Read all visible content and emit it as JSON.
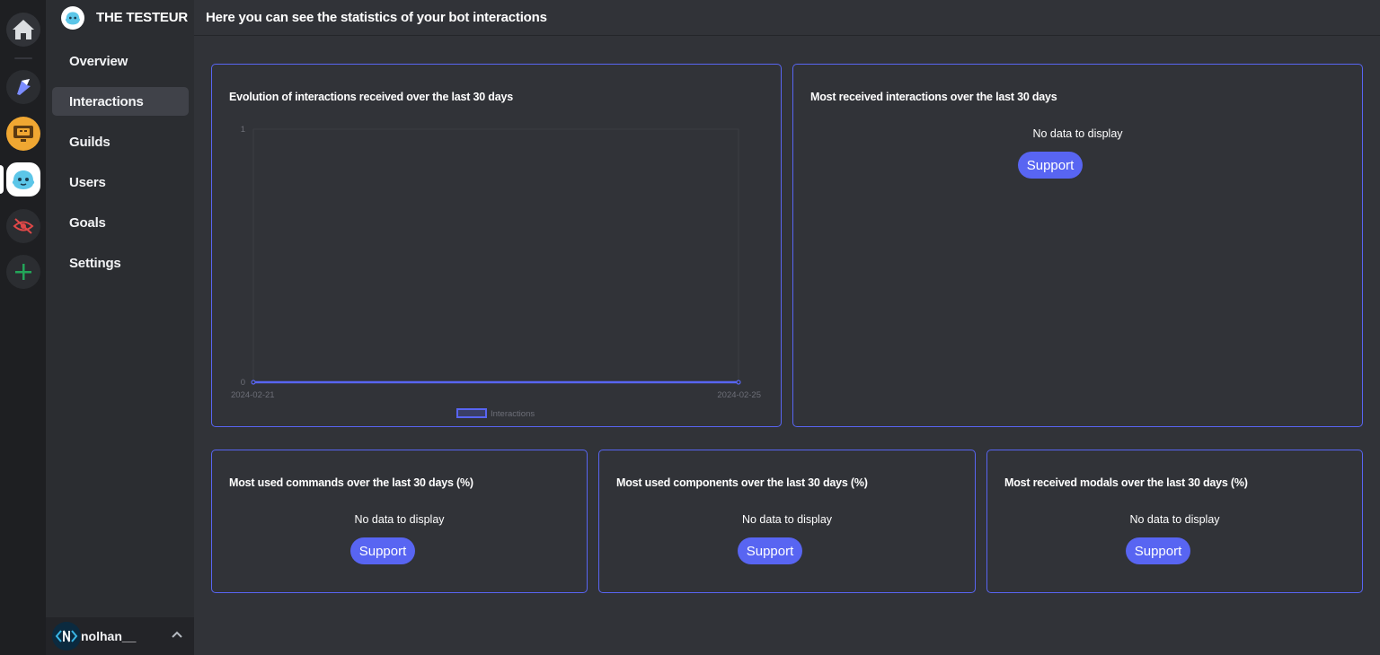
{
  "bot": {
    "name": "THE TESTEUR"
  },
  "header": {
    "title": "Here you can see the statistics of your bot interactions"
  },
  "nav": {
    "items": [
      {
        "label": "Overview"
      },
      {
        "label": "Interactions"
      },
      {
        "label": "Guilds"
      },
      {
        "label": "Users"
      },
      {
        "label": "Goals"
      },
      {
        "label": "Settings"
      }
    ],
    "active": "Interactions"
  },
  "user": {
    "name": "nolhan__"
  },
  "rail": {
    "icons": [
      "home-icon",
      "bot-server-icon",
      "monitor-bot-server-icon",
      "testeur-bot-server-icon",
      "hidden-eye-server-icon",
      "add-server-icon"
    ]
  },
  "cards": {
    "evolution": {
      "title": "Evolution of interactions received over the last 30 days"
    },
    "most_received": {
      "title": "Most received interactions over the last 30 days",
      "empty": "No data to display",
      "button": "Support"
    },
    "commands": {
      "title": "Most used commands over the last 30 days (%)",
      "empty": "No data to display",
      "button": "Support"
    },
    "components": {
      "title": "Most used components over the last 30 days (%)",
      "empty": "No data to display",
      "button": "Support"
    },
    "modals": {
      "title": "Most received modals over the last 30 days (%)",
      "empty": "No data to display",
      "button": "Support"
    }
  },
  "colors": {
    "accent": "#5865f2",
    "background": "#313338",
    "sidebar": "#2b2d31",
    "rail": "#1e1f22"
  },
  "chart_data": {
    "type": "line",
    "x": [
      "2024-02-21",
      "2024-02-25"
    ],
    "series": [
      {
        "name": "Interactions",
        "values": [
          0,
          0
        ]
      }
    ],
    "y_ticks": [
      0,
      1
    ],
    "ylim": [
      0,
      1
    ],
    "legend": "bottom",
    "grid": true,
    "color": "#5865f2"
  }
}
